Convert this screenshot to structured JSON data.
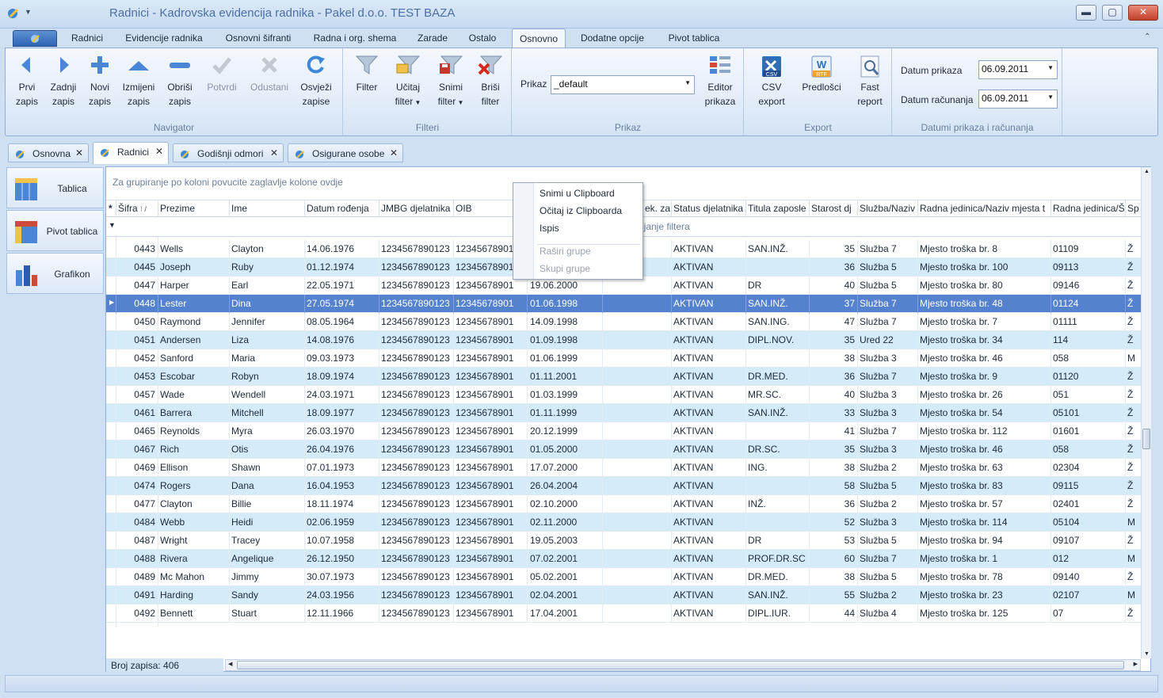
{
  "window": {
    "title": "Radnici - Kadrovska evidencija radnika - Pakel d.o.o. TEST BAZA",
    "minimize": "▬",
    "maximize": "▢",
    "close": "✕"
  },
  "ribbon_tabs": [
    "Radnici",
    "Evidencije radnika",
    "Osnovni šifranti",
    "Radna i org. shema",
    "Zarade",
    "Ostalo",
    "Osnovno",
    "Dodatne opcije",
    "Pivot tablica"
  ],
  "active_ribbon_tab": "Osnovno",
  "ribbon": {
    "navigator": {
      "label": "Navigator",
      "buttons": [
        {
          "label": "Prvi\nzapis",
          "icon": "arrow-left-icon"
        },
        {
          "label": "Zadnji\nzapis",
          "icon": "arrow-right-icon"
        },
        {
          "label": "Novi\nzapis",
          "icon": "plus-icon"
        },
        {
          "label": "Izmijeni\nzapis",
          "icon": "triangle-up-icon"
        },
        {
          "label": "Obriši\nzapis",
          "icon": "minus-icon"
        },
        {
          "label": "Potvrdi",
          "icon": "check-icon"
        },
        {
          "label": "Odustani",
          "icon": "x-icon"
        },
        {
          "label": "Osvježi\nzapise",
          "icon": "refresh-icon"
        }
      ]
    },
    "filteri": {
      "label": "Filteri",
      "buttons": [
        {
          "label": "Filter",
          "icon": "funnel-icon"
        },
        {
          "label": "Učitaj\nfilter",
          "icon": "funnel-open-icon"
        },
        {
          "label": "Snimi\nfilter",
          "icon": "funnel-save-icon"
        },
        {
          "label": "Briši\nfilter",
          "icon": "funnel-delete-icon"
        }
      ]
    },
    "prikaz": {
      "label": "Prikaz",
      "field_label": "Prikaz",
      "field_value": "_default",
      "editor_button": "Editor\nprikaza"
    },
    "export": {
      "label": "Export",
      "buttons": [
        {
          "label": "CSV\nexport",
          "icon": "csv-icon",
          "badge": "CSV"
        },
        {
          "label": "Predlošci",
          "icon": "rtf-template-icon",
          "badge": "RTF"
        },
        {
          "label": "Fast\nreport",
          "icon": "fast-report-icon"
        }
      ]
    },
    "datumi": {
      "label": "Datumi prikaza i računanja",
      "datum_prikaza_label": "Datum prikaza",
      "datum_prikaza_value": "06.09.2011",
      "datum_racunanja_label": "Datum računanja",
      "datum_racunanja_value": "06.09.2011"
    }
  },
  "doc_tabs": [
    "Osnovna",
    "Radnici",
    "Godišnji odmori",
    "Osigurane osobe"
  ],
  "active_doc_tab": "Radnici",
  "side_panel": [
    "Tablica",
    "Pivot tablica",
    "Grafikon"
  ],
  "grid": {
    "group_hint": "Za grupiranje po koloni povucite zaglavlje kolone ovdje",
    "filter_hint": "vljanje filtera",
    "columns": [
      "Šifra",
      "Prezime",
      "Ime",
      "Datum rođenja",
      "JMBG djelatnika",
      "OIB",
      "",
      "ek. za",
      "Status djelatnika",
      "Titula zaposle",
      "Starost dj",
      "Služba/Naziv",
      "Radna jedinica/Naziv mjesta t",
      "Radna jedinica/Š",
      "Sp"
    ],
    "rows": [
      [
        "0443",
        "Wells",
        "Clayton",
        "14.06.1976",
        "1234567890123",
        "12345678901",
        "",
        "",
        "AKTIVAN",
        "SAN.INŽ.",
        "35",
        "Služba 7",
        "Mjesto troška br. 8",
        "01109",
        "Ž"
      ],
      [
        "0445",
        "Joseph",
        "Ruby",
        "01.12.1974",
        "1234567890123",
        "12345678901",
        "",
        "",
        "AKTIVAN",
        "",
        "36",
        "Služba 5",
        "Mjesto troška br. 100",
        "09113",
        "Ž"
      ],
      [
        "0447",
        "Harper",
        "Earl",
        "22.05.1971",
        "1234567890123",
        "12345678901",
        "19.06.2000",
        "",
        "AKTIVAN",
        "DR",
        "40",
        "Služba 5",
        "Mjesto troška br. 80",
        "09146",
        "Ž"
      ],
      [
        "0448",
        "Lester",
        "Dina",
        "27.05.1974",
        "1234567890123",
        "12345678901",
        "01.06.1998",
        "",
        "AKTIVAN",
        "SAN.INŽ.",
        "37",
        "Služba 7",
        "Mjesto troška br. 48",
        "01124",
        "Ž"
      ],
      [
        "0450",
        "Raymond",
        "Jennifer",
        "08.05.1964",
        "1234567890123",
        "12345678901",
        "14.09.1998",
        "",
        "AKTIVAN",
        "SAN.ING.",
        "47",
        "Služba 7",
        "Mjesto troška br. 7",
        "01111",
        "Ž"
      ],
      [
        "0451",
        "Andersen",
        "Liza",
        "14.08.1976",
        "1234567890123",
        "12345678901",
        "01.09.1998",
        "",
        "AKTIVAN",
        "DIPL.NOV.",
        "35",
        "Ured 22",
        "Mjesto troška br. 34",
        "114",
        "Ž"
      ],
      [
        "0452",
        "Sanford",
        "Maria",
        "09.03.1973",
        "1234567890123",
        "12345678901",
        "01.06.1999",
        "",
        "AKTIVAN",
        "",
        "38",
        "Služba 3",
        "Mjesto troška br. 46",
        "058",
        "M"
      ],
      [
        "0453",
        "Escobar",
        "Robyn",
        "18.09.1974",
        "1234567890123",
        "12345678901",
        "01.11.2001",
        "",
        "AKTIVAN",
        "DR.MED.",
        "36",
        "Služba 7",
        "Mjesto troška br. 9",
        "01120",
        "Ž"
      ],
      [
        "0457",
        "Wade",
        "Wendell",
        "24.03.1971",
        "1234567890123",
        "12345678901",
        "01.03.1999",
        "",
        "AKTIVAN",
        "MR.SC.",
        "40",
        "Služba 3",
        "Mjesto troška br. 26",
        "051",
        "Ž"
      ],
      [
        "0461",
        "Barrera",
        "Mitchell",
        "18.09.1977",
        "1234567890123",
        "12345678901",
        "01.11.1999",
        "",
        "AKTIVAN",
        "SAN.INŽ.",
        "33",
        "Služba 3",
        "Mjesto troška br. 54",
        "05101",
        "Ž"
      ],
      [
        "0465",
        "Reynolds",
        "Myra",
        "26.03.1970",
        "1234567890123",
        "12345678901",
        "20.12.1999",
        "",
        "AKTIVAN",
        "",
        "41",
        "Služba 7",
        "Mjesto troška br. 112",
        "01601",
        "Ž"
      ],
      [
        "0467",
        "Rich",
        "Otis",
        "26.04.1976",
        "1234567890123",
        "12345678901",
        "01.05.2000",
        "",
        "AKTIVAN",
        "DR.SC.",
        "35",
        "Služba 3",
        "Mjesto troška br. 46",
        "058",
        "Ž"
      ],
      [
        "0469",
        "Ellison",
        "Shawn",
        "07.01.1973",
        "1234567890123",
        "12345678901",
        "17.07.2000",
        "",
        "AKTIVAN",
        "ING.",
        "38",
        "Služba 2",
        "Mjesto troška br. 63",
        "02304",
        "Ž"
      ],
      [
        "0474",
        "Rogers",
        "Dana",
        "16.04.1953",
        "1234567890123",
        "12345678901",
        "26.04.2004",
        "",
        "AKTIVAN",
        "",
        "58",
        "Služba 5",
        "Mjesto troška br. 83",
        "09115",
        "Ž"
      ],
      [
        "0477",
        "Clayton",
        "Billie",
        "18.11.1974",
        "1234567890123",
        "12345678901",
        "02.10.2000",
        "",
        "AKTIVAN",
        "INŽ.",
        "36",
        "Služba 2",
        "Mjesto troška br. 57",
        "02401",
        "Ž"
      ],
      [
        "0484",
        "Webb",
        "Heidi",
        "02.06.1959",
        "1234567890123",
        "12345678901",
        "02.11.2000",
        "",
        "AKTIVAN",
        "",
        "52",
        "Služba 3",
        "Mjesto troška br. 114",
        "05104",
        "M"
      ],
      [
        "0487",
        "Wright",
        "Tracey",
        "10.07.1958",
        "1234567890123",
        "12345678901",
        "19.05.2003",
        "",
        "AKTIVAN",
        "DR",
        "53",
        "Služba 5",
        "Mjesto troška br. 94",
        "09107",
        "Ž"
      ],
      [
        "0488",
        "Rivera",
        "Angelique",
        "26.12.1950",
        "1234567890123",
        "12345678901",
        "07.02.2001",
        "",
        "AKTIVAN",
        "PROF.DR.SC",
        "60",
        "Služba 7",
        "Mjesto troška br. 1",
        "012",
        "M"
      ],
      [
        "0489",
        "Mc Mahon",
        "Jimmy",
        "30.07.1973",
        "1234567890123",
        "12345678901",
        "05.02.2001",
        "",
        "AKTIVAN",
        "DR.MED.",
        "38",
        "Služba 5",
        "Mjesto troška br. 78",
        "09140",
        "Ž"
      ],
      [
        "0491",
        "Harding",
        "Sandy",
        "24.03.1956",
        "1234567890123",
        "12345678901",
        "02.04.2001",
        "",
        "AKTIVAN",
        "SAN.INŽ.",
        "55",
        "Služba 2",
        "Mjesto troška br. 23",
        "02107",
        "M"
      ],
      [
        "0492",
        "Bennett",
        "Stuart",
        "12.11.1966",
        "1234567890123",
        "12345678901",
        "17.04.2001",
        "",
        "AKTIVAN",
        "DIPL.IUR.",
        "44",
        "Služba 4",
        "Mjesto troška br. 125",
        "07",
        "Ž"
      ]
    ],
    "selected_row": 3,
    "record_count": "Broj zapisa: 406"
  },
  "context_menu": {
    "items": [
      "Snimi u Clipboard",
      "Očitaj iz Clipboarda",
      "Ispis"
    ],
    "disabled_items": [
      "Raširi grupe",
      "Skupi grupe"
    ]
  }
}
